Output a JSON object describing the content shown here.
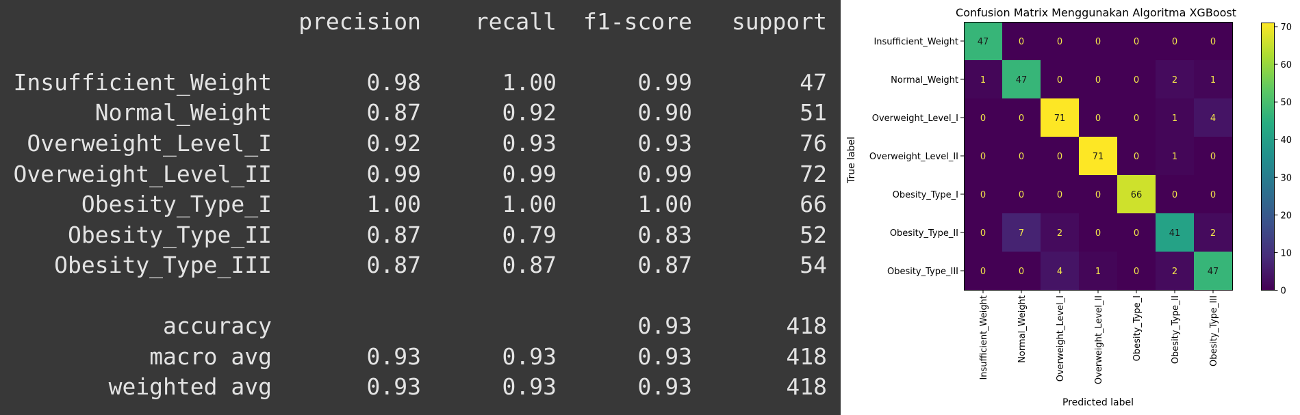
{
  "report": {
    "headers": [
      "precision",
      "recall",
      "f1-score",
      "support"
    ],
    "rows": [
      {
        "label": "Insufficient_Weight",
        "precision": "0.98",
        "recall": "1.00",
        "f1": "0.99",
        "support": "47"
      },
      {
        "label": "Normal_Weight",
        "precision": "0.87",
        "recall": "0.92",
        "f1": "0.90",
        "support": "51"
      },
      {
        "label": "Overweight_Level_I",
        "precision": "0.92",
        "recall": "0.93",
        "f1": "0.93",
        "support": "76"
      },
      {
        "label": "Overweight_Level_II",
        "precision": "0.99",
        "recall": "0.99",
        "f1": "0.99",
        "support": "72"
      },
      {
        "label": "Obesity_Type_I",
        "precision": "1.00",
        "recall": "1.00",
        "f1": "1.00",
        "support": "66"
      },
      {
        "label": "Obesity_Type_II",
        "precision": "0.87",
        "recall": "0.79",
        "f1": "0.83",
        "support": "52"
      },
      {
        "label": "Obesity_Type_III",
        "precision": "0.87",
        "recall": "0.87",
        "f1": "0.87",
        "support": "54"
      }
    ],
    "summary": [
      {
        "label": "accuracy",
        "precision": "",
        "recall": "",
        "f1": "0.93",
        "support": "418"
      },
      {
        "label": "macro avg",
        "precision": "0.93",
        "recall": "0.93",
        "f1": "0.93",
        "support": "418"
      },
      {
        "label": "weighted avg",
        "precision": "0.93",
        "recall": "0.93",
        "f1": "0.93",
        "support": "418"
      }
    ],
    "colors": {
      "background": "#383838",
      "text": "#e3e3e3"
    }
  },
  "chart_data": {
    "type": "heatmap",
    "title": "Confusion Matrix Menggunakan Algoritma XGBoost",
    "xlabel": "Predicted label",
    "ylabel": "True label",
    "labels": [
      "Insufficient_Weight",
      "Normal_Weight",
      "Overweight_Level_I",
      "Overweight_Level_II",
      "Obesity_Type_I",
      "Obesity_Type_II",
      "Obesity_Type_III"
    ],
    "matrix": [
      [
        47,
        0,
        0,
        0,
        0,
        0,
        0
      ],
      [
        1,
        47,
        0,
        0,
        0,
        2,
        1
      ],
      [
        0,
        0,
        71,
        0,
        0,
        1,
        4
      ],
      [
        0,
        0,
        0,
        71,
        0,
        1,
        0
      ],
      [
        0,
        0,
        0,
        0,
        66,
        0,
        0
      ],
      [
        0,
        7,
        2,
        0,
        0,
        41,
        2
      ],
      [
        0,
        0,
        4,
        1,
        0,
        2,
        47
      ]
    ],
    "colormap": "viridis",
    "vmin": 0,
    "vmax": 71,
    "colorbar_ticks": [
      0,
      10,
      20,
      30,
      40,
      50,
      60,
      70
    ]
  }
}
